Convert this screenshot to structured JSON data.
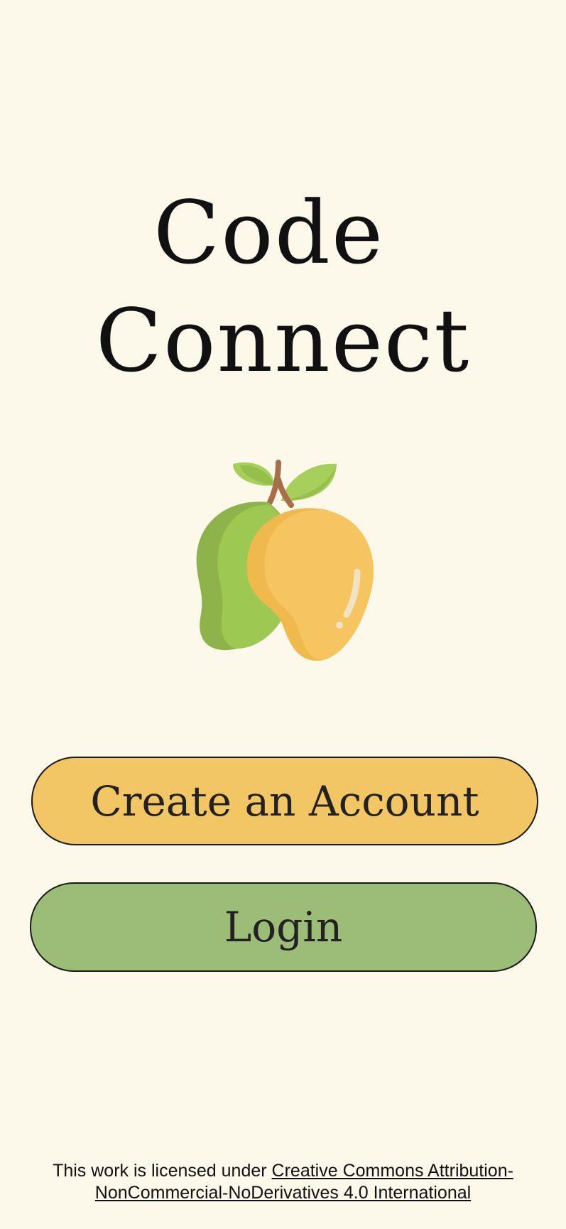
{
  "title": {
    "line1": "Code",
    "line2": "Connect"
  },
  "logo": {
    "icon": "mango-icon"
  },
  "buttons": {
    "create_account": "Create an Account",
    "login": "Login"
  },
  "footer": {
    "prefix": "This work is licensed under ",
    "link_line1": "Creative Commons Attribution-",
    "link_line2": "NonCommercial-NoDerivatives 4.0 International "
  },
  "colors": {
    "background": "#fdf9ea",
    "create_button": "#f2c565",
    "login_button": "#9cbd78"
  }
}
